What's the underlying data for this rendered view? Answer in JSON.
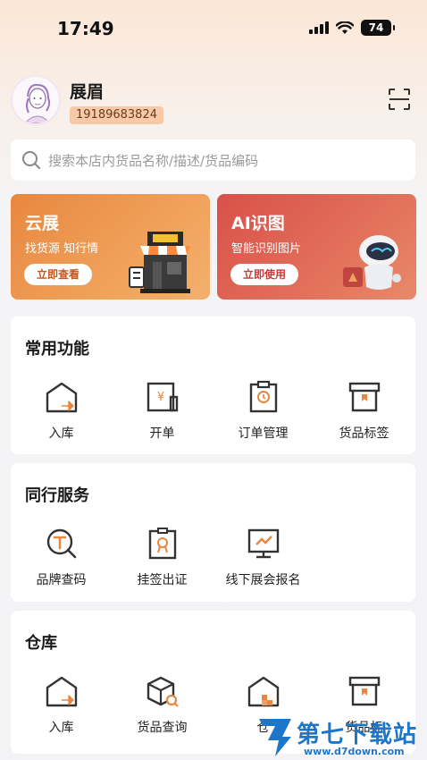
{
  "status_bar": {
    "time": "17:49",
    "battery": "74"
  },
  "profile": {
    "name": "展眉",
    "phone": "19189683824"
  },
  "search": {
    "placeholder": "搜索本店内货品名称/描述/货品编码"
  },
  "promos": [
    {
      "title": "云展",
      "subtitle": "找货源 知行情",
      "button": "立即查看",
      "color": "#e8873f"
    },
    {
      "title": "AI识图",
      "subtitle": "智能识别图片",
      "button": "立即使用",
      "color": "#d9504a"
    }
  ],
  "sections": {
    "common": {
      "title": "常用功能",
      "items": [
        "入库",
        "开单",
        "订单管理",
        "货品标签"
      ]
    },
    "peer": {
      "title": "同行服务",
      "items": [
        "品牌查码",
        "挂签出证",
        "线下展会报名"
      ]
    },
    "warehouse": {
      "title": "仓库",
      "items": [
        "入库",
        "货品查询",
        "仓",
        "货品标"
      ]
    }
  },
  "watermark": {
    "text": "第七下载站",
    "url": "www.d7down.com"
  },
  "colors": {
    "accent": "#e8873f",
    "icon": "#333333",
    "icon_accent": "#e8873f"
  }
}
